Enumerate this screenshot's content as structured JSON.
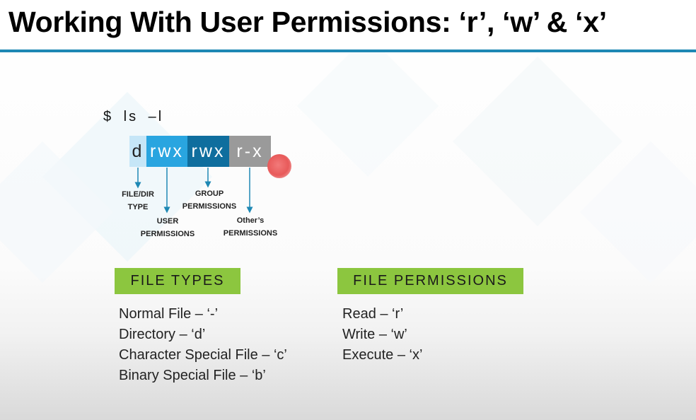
{
  "slide": {
    "title": "Working With User Permissions: ‘r’, ‘w’ & ‘x’",
    "title_rule_color": "#1e88b4"
  },
  "diagram": {
    "command": "$ ls –l",
    "permission_string": {
      "type_char": "d",
      "user": "rwx",
      "group": "rwx",
      "other": "r-x",
      "colors": {
        "type": "#c6e6f7",
        "user": "#29a5e0",
        "group": "#0f6e9e",
        "other": "#9a9a9a"
      }
    },
    "labels": {
      "type_line1": "FILE/DIR",
      "type_line2": "TYPE",
      "user_line1": "USER",
      "user_line2": "PERMISSIONS",
      "group_line1": "GROUP",
      "group_line2": "PERMISSIONS",
      "other_line1": "Other’s",
      "other_line2": "PERMISSIONS"
    },
    "arrow_color": "#1e88b4",
    "cursor_color": "#e85a5a"
  },
  "file_types": {
    "header": "FILE TYPES",
    "items": [
      "Normal File – ‘-’",
      "Directory – ‘d’",
      "Character Special File – ‘c’",
      "Binary Special File – ‘b’"
    ]
  },
  "file_permissions": {
    "header": "FILE PERMISSIONS",
    "items": [
      "Read – ‘r’",
      "Write – ‘w’",
      "Execute – ‘x’"
    ]
  },
  "header_color": "#8cc63f"
}
